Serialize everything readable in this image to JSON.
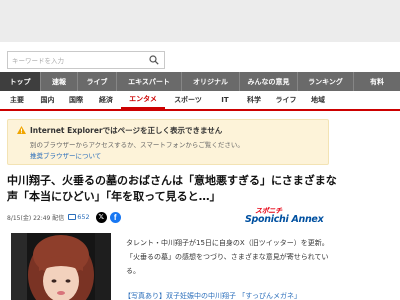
{
  "search": {
    "placeholder": "キーワードを入力"
  },
  "nav_primary": [
    {
      "label": "トップ",
      "active": true
    },
    {
      "label": "速報",
      "active": false
    },
    {
      "label": "ライブ",
      "active": false
    },
    {
      "label": "エキスパート",
      "active": false
    },
    {
      "label": "オリジナル",
      "active": false
    },
    {
      "label": "みんなの意見",
      "active": false
    },
    {
      "label": "ランキング",
      "active": false
    },
    {
      "label": "有料",
      "active": false
    }
  ],
  "nav_secondary": [
    {
      "label": "主要",
      "active": false
    },
    {
      "label": "国内",
      "active": false
    },
    {
      "label": "国際",
      "active": false
    },
    {
      "label": "経済",
      "active": false
    },
    {
      "label": "エンタメ",
      "active": true
    },
    {
      "label": "スポーツ",
      "active": false
    },
    {
      "label": "IT",
      "active": false
    },
    {
      "label": "科学",
      "active": false
    },
    {
      "label": "ライフ",
      "active": false
    },
    {
      "label": "地域",
      "active": false
    }
  ],
  "notice": {
    "title": "Internet Explorerではページを正しく表示できません",
    "body": "別のブラウザーからアクセスするか、スマートフォンからご覧ください。",
    "link": "推奨ブラウザーについて"
  },
  "article": {
    "headline": "中川翔子、火垂るの墓のおばさんは「意地悪すぎる」にさまざまな声「本当にひどい」「年を取って見ると…」",
    "meta": "8/15(金) 22:49 配信",
    "comment_count": "652",
    "source_logo_top": "スポニチ",
    "source_logo_main": "Sponichi Annex",
    "body": "タレント・中川翔子が15日に自身のX（旧ツイッター）を更新。「火垂るの墓」の感想をつづり、さまざまな意見が寄せられている。",
    "related": "【写真あり】双子妊娠中の中川翔子 「すっぴんメガネ」"
  },
  "colors": {
    "nav_bg": "#6a6a6a",
    "nav_active": "#3e3e3e",
    "accent_red": "#cc0000",
    "link_blue": "#2a6ebb",
    "notice_bg": "#fdf3d9"
  }
}
